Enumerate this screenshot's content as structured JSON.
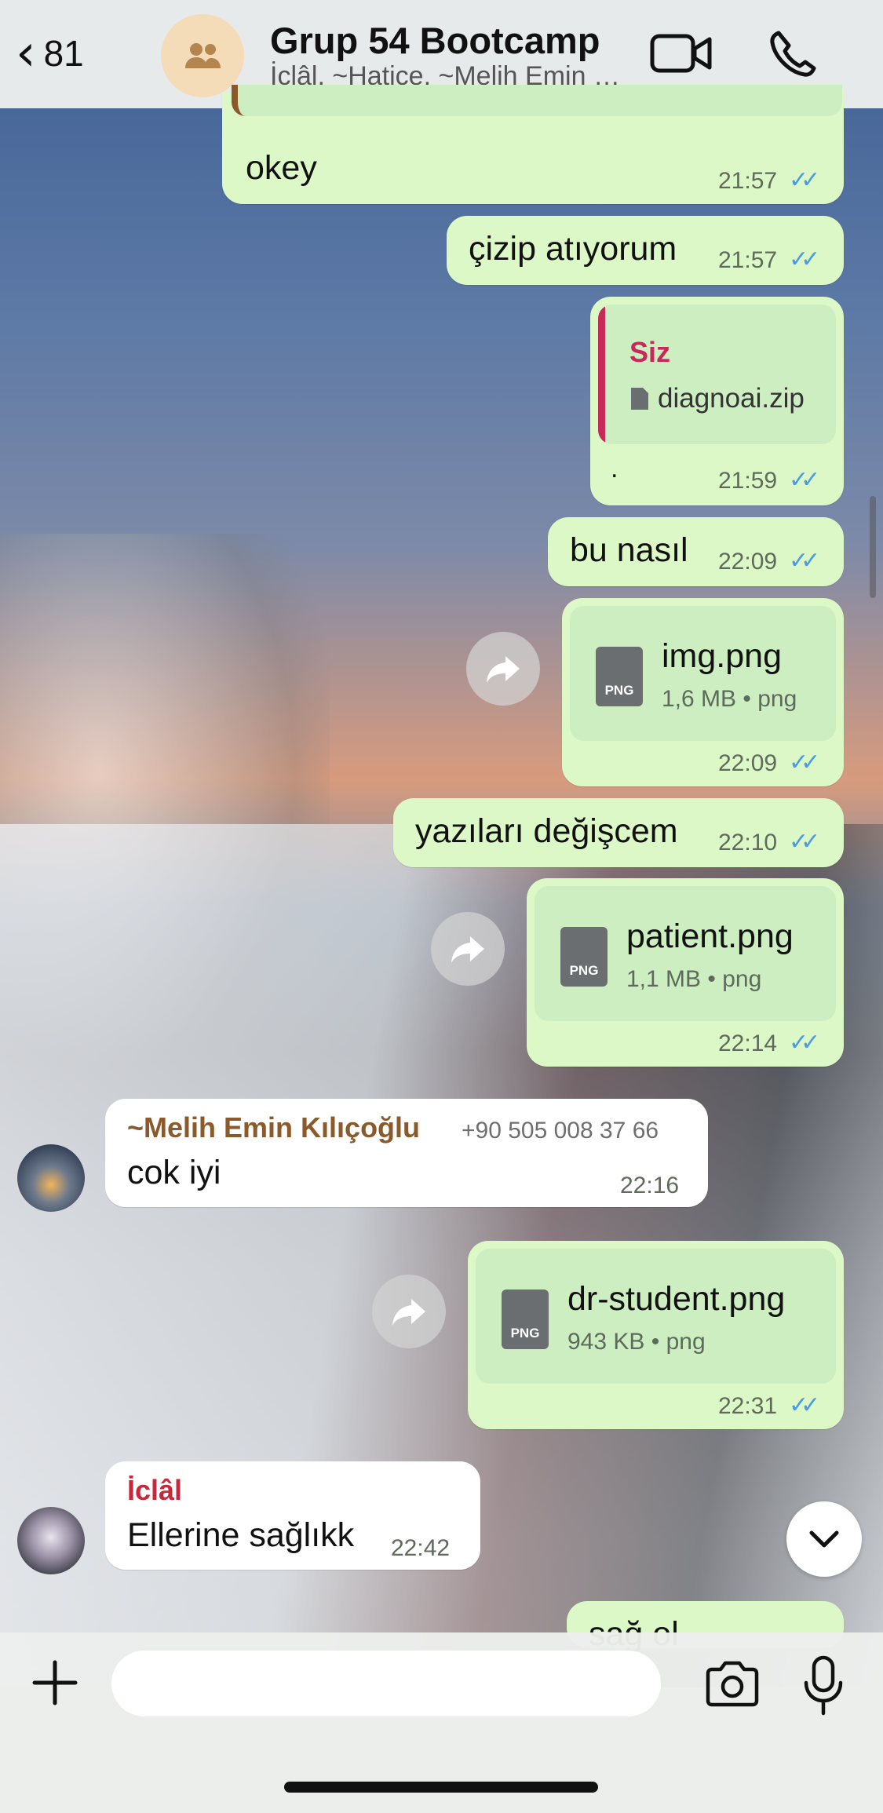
{
  "header": {
    "back_count": "81",
    "title": "Grup 54 Bootcamp",
    "subtitle": "İclâl, ~Hatice, ~Melih Emin Kılıçoğlu"
  },
  "messages": {
    "m1": {
      "text": "okey",
      "time": "21:57"
    },
    "m2": {
      "text": "çizip atıyorum",
      "time": "21:57"
    },
    "m3": {
      "quote_sender": "Siz",
      "quote_file": "diagnoai.zip",
      "text": ".",
      "time": "21:59"
    },
    "m4": {
      "text": "bu nasıl",
      "time": "22:09"
    },
    "m5": {
      "file_name": "img.png",
      "file_meta": "1,6 MB • png",
      "icon_label": "PNG",
      "time": "22:09"
    },
    "m6": {
      "text": "yazıları değişcem",
      "time": "22:10"
    },
    "m7": {
      "file_name": "patient.png",
      "file_meta": "1,1 MB • png",
      "icon_label": "PNG",
      "time": "22:14"
    },
    "m8": {
      "sender": "~Melih Emin Kılıçoğlu",
      "phone": "+90 505 008 37 66",
      "text": "cok iyi",
      "time": "22:16"
    },
    "m9": {
      "file_name": "dr-student.png",
      "file_meta": "943 KB • png",
      "icon_label": "PNG",
      "time": "22:31"
    },
    "m10": {
      "sender": "İclâl",
      "text": "Ellerine sağlıkk",
      "time": "22:42"
    },
    "m11": {
      "text": "sağ ol"
    }
  },
  "colors": {
    "outgoing_bubble": "#dcf8c6",
    "incoming_bubble": "#ffffff",
    "read_ticks": "#4b9be3",
    "sender_melih": "#8b5a2b",
    "sender_iclal": "#c8283c",
    "quote_bar": "#c8285a"
  },
  "icons": [
    "back-chevron-icon",
    "group-avatar-icon",
    "video-call-icon",
    "phone-call-icon",
    "forward-icon",
    "document-icon",
    "plus-icon",
    "sticker-icon",
    "camera-icon",
    "microphone-icon",
    "chevron-down-icon"
  ]
}
